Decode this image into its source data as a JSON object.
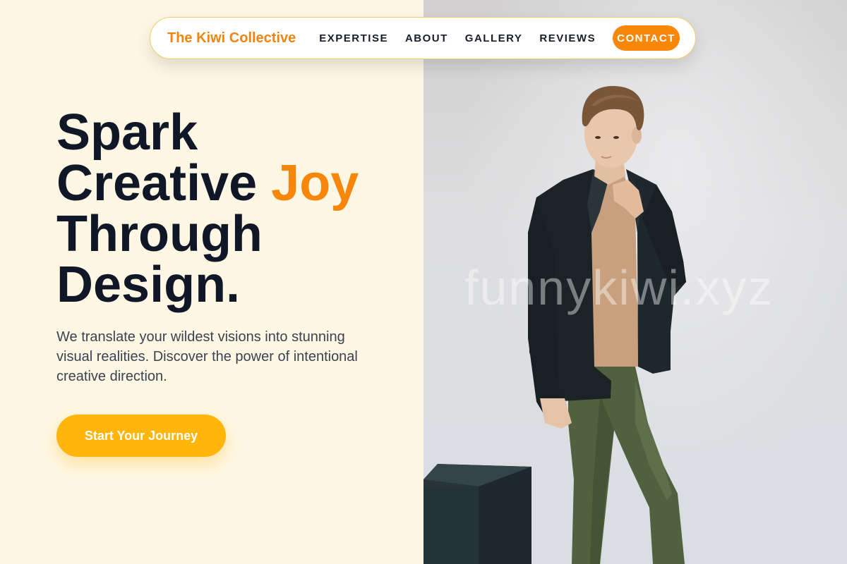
{
  "brand": {
    "name": "The Kiwi Collective"
  },
  "nav": {
    "links": [
      "EXPERTISE",
      "ABOUT",
      "GALLERY",
      "REVIEWS"
    ],
    "contact_label": "CONTACT"
  },
  "hero": {
    "title_line1": "Spark",
    "title_line2_start": "Creative ",
    "title_line2_accent": "Joy",
    "title_line3": "Through",
    "title_line4": "Design.",
    "subtitle": "We translate your wildest visions into stunning visual realities. Discover the power of intentional creative direction.",
    "cta_label": "Start Your Journey"
  },
  "watermark": "funnykiwi.xyz",
  "colors": {
    "accent": "#f7860a",
    "cta": "#ffb50a",
    "left_bg": "#fef7e3",
    "heading": "#101828"
  }
}
